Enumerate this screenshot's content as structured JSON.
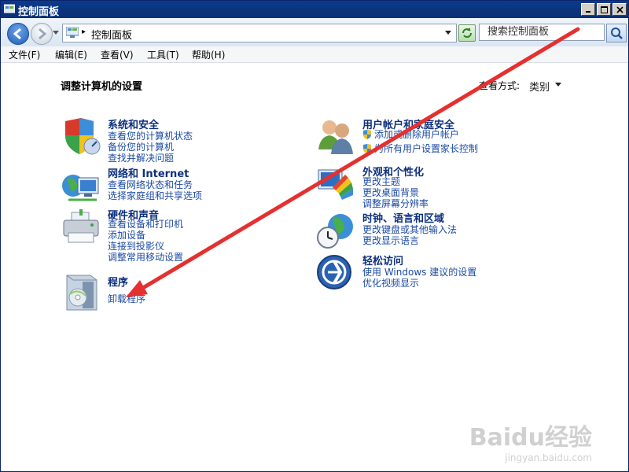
{
  "window": {
    "title": "控制面板"
  },
  "address": {
    "path_sep": "▸",
    "location": "控制面板",
    "search_placeholder": "搜索控制面板"
  },
  "menu": [
    "文件(F)",
    "编辑(E)",
    "查看(V)",
    "工具(T)",
    "帮助(H)"
  ],
  "content": {
    "heading": "调整计算机的设置",
    "view_by_label": "查看方式:",
    "view_by_value": "类别"
  },
  "categories": {
    "security": {
      "title": "系统和安全",
      "links": [
        "查看您的计算机状态",
        "备份您的计算机",
        "查找并解决问题"
      ]
    },
    "network": {
      "title": "网络和 Internet",
      "links": [
        "查看网络状态和任务",
        "选择家庭组和共享选项"
      ]
    },
    "hardware": {
      "title": "硬件和声音",
      "links": [
        "查看设备和打印机",
        "添加设备",
        "连接到投影仪",
        "调整常用移动设置"
      ]
    },
    "programs": {
      "title": "程序",
      "links": [
        "卸载程序"
      ]
    },
    "users": {
      "title": "用户帐户和家庭安全",
      "links": [
        "添加或删除用户帐户",
        "为所有用户设置家长控制"
      ]
    },
    "appearance": {
      "title": "外观和个性化",
      "links": [
        "更改主题",
        "更改桌面背景",
        "调整屏幕分辨率"
      ]
    },
    "clock": {
      "title": "时钟、语言和区域",
      "links": [
        "更改键盘或其他输入法",
        "更改显示语言"
      ]
    },
    "ease": {
      "title": "轻松访问",
      "links": [
        "使用 Windows 建议的设置",
        "优化视频显示"
      ]
    }
  },
  "watermark": {
    "brand": "Baidu经验",
    "url": "jingyan.baidu.com"
  },
  "colors": {
    "titlebar": "#0a2f74",
    "link": "#1b4aa3",
    "category_title": "#0d2f7d",
    "annotation_arrow": "#e53030"
  }
}
